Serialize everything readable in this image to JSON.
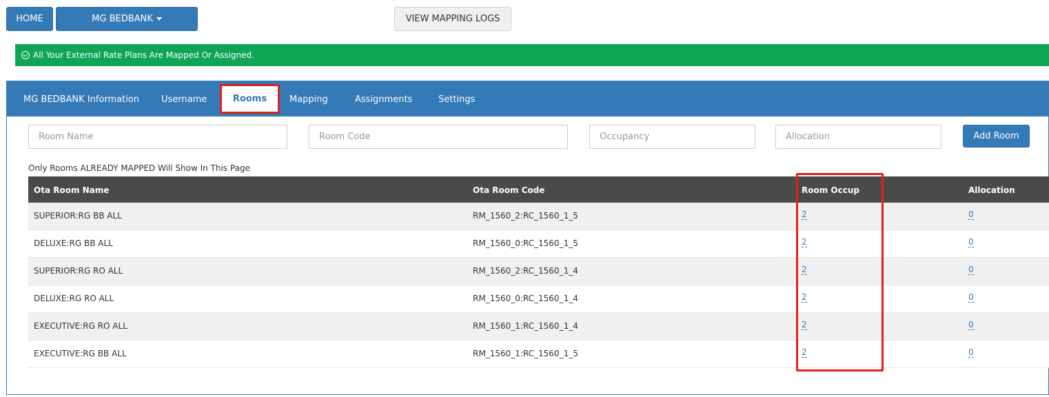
{
  "top": {
    "home_label": "HOME",
    "brand_label": "MG BEDBANK",
    "view_logs_label": "VIEW MAPPING LOGS"
  },
  "banner": {
    "message": "All Your External Rate Plans Are Mapped Or Assigned.",
    "color": "#0ea654"
  },
  "tabs": [
    {
      "label": "MG BEDBANK Information"
    },
    {
      "label": "Username"
    },
    {
      "label": "Rooms",
      "active": true
    },
    {
      "label": "Mapping"
    },
    {
      "label": "Assignments"
    },
    {
      "label": "Settings"
    }
  ],
  "form": {
    "room_name_placeholder": "Room Name",
    "room_code_placeholder": "Room Code",
    "occupancy_placeholder": "Occupancy",
    "allocation_placeholder": "Allocation",
    "add_room_label": "Add Room"
  },
  "note": "Only Rooms ALREADY MAPPED Will Show In This Page",
  "table": {
    "headers": [
      "Ota Room Name",
      "Ota Room Code",
      "Room Occup",
      "Allocation"
    ],
    "rows": [
      {
        "name": "SUPERIOR:RG BB ALL",
        "code": "RM_1560_2:RC_1560_1_5",
        "occup": "2",
        "allocation": "0"
      },
      {
        "name": "DELUXE:RG BB ALL",
        "code": "RM_1560_0:RC_1560_1_5",
        "occup": "2",
        "allocation": "0"
      },
      {
        "name": "SUPERIOR:RG RO ALL",
        "code": "RM_1560_2:RC_1560_1_4",
        "occup": "2",
        "allocation": "0"
      },
      {
        "name": "DELUXE:RG RO ALL",
        "code": "RM_1560_0:RC_1560_1_4",
        "occup": "2",
        "allocation": "0"
      },
      {
        "name": "EXECUTIVE:RG RO ALL",
        "code": "RM_1560_1:RC_1560_1_4",
        "occup": "2",
        "allocation": "0"
      },
      {
        "name": "EXECUTIVE:RG BB ALL",
        "code": "RM_1560_1:RC_1560_1_5",
        "occup": "2",
        "allocation": "0"
      }
    ]
  },
  "colors": {
    "primary": "#337ab7",
    "table_header": "#4a4a4a",
    "highlight": "#e0201b"
  }
}
